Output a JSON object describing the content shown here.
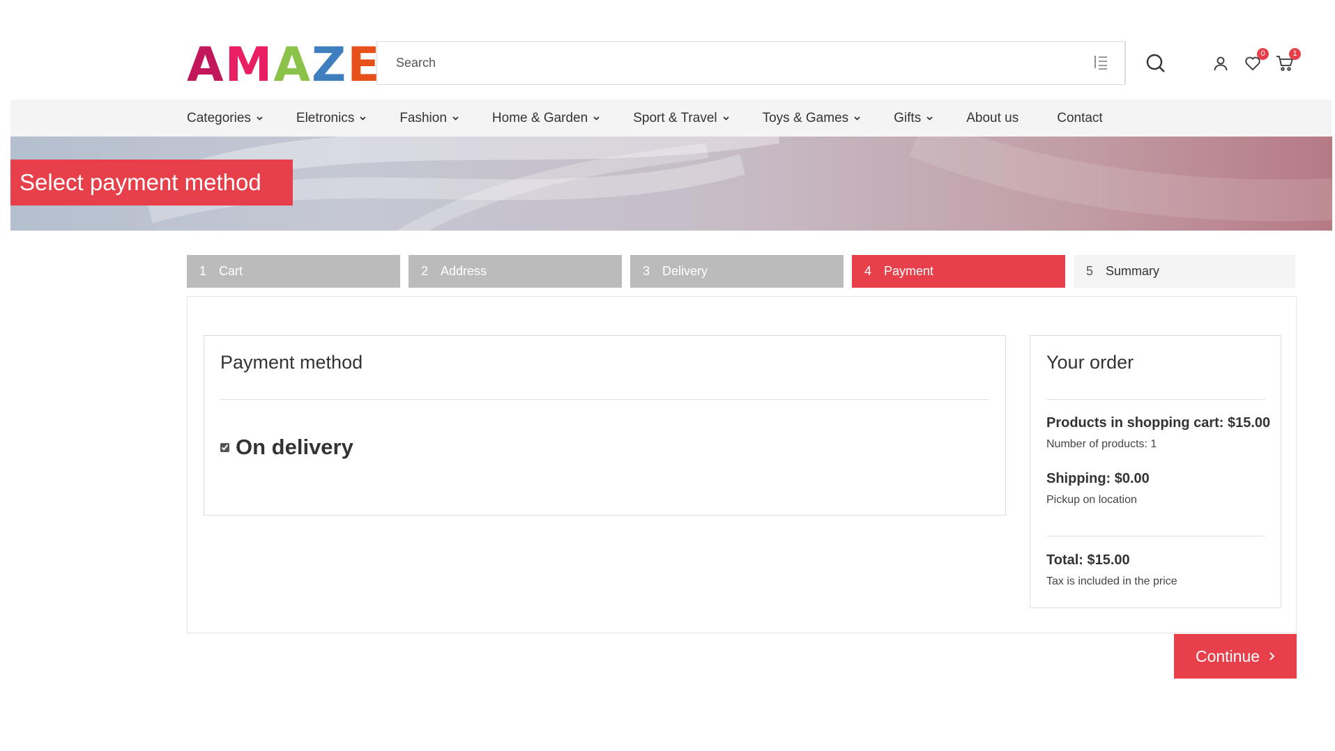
{
  "logo": {
    "letters": [
      "A",
      "M",
      "A",
      "Z",
      "E"
    ],
    "colors": [
      "#c2185b",
      "#e91e63",
      "#8bc34a",
      "#3f7fbf",
      "#e8501a"
    ]
  },
  "search": {
    "placeholder": "Search"
  },
  "header": {
    "wishlist_count": "0",
    "cart_count": "1"
  },
  "nav": {
    "items": [
      {
        "label": "Categories",
        "dropdown": true
      },
      {
        "label": "Eletronics",
        "dropdown": true
      },
      {
        "label": "Fashion",
        "dropdown": true
      },
      {
        "label": "Home & Garden",
        "dropdown": true
      },
      {
        "label": "Sport & Travel",
        "dropdown": true
      },
      {
        "label": "Toys & Games",
        "dropdown": true
      },
      {
        "label": "Gifts",
        "dropdown": true
      },
      {
        "label": "About us",
        "dropdown": false
      },
      {
        "label": "Contact",
        "dropdown": false
      }
    ]
  },
  "banner": {
    "title": "Select payment method"
  },
  "steps": [
    {
      "num": "1",
      "label": "Cart",
      "state": "done"
    },
    {
      "num": "2",
      "label": "Address",
      "state": "done"
    },
    {
      "num": "3",
      "label": "Delivery",
      "state": "done"
    },
    {
      "num": "4",
      "label": "Payment",
      "state": "active"
    },
    {
      "num": "5",
      "label": "Summary",
      "state": "future"
    }
  ],
  "payment": {
    "title": "Payment method",
    "option_label": "On delivery",
    "option_checked": true
  },
  "order": {
    "title": "Your order",
    "products_line": "Products in shopping cart: $15.00",
    "products_count": "Number of products: 1",
    "shipping_line": "Shipping: $0.00",
    "shipping_method": "Pickup on location",
    "total_line": "Total: $15.00",
    "tax_note": "Tax is included in the price"
  },
  "continue_label": "Continue",
  "colors": {
    "accent": "#e8404a",
    "step_done": "#bbbbbb",
    "nav_bg": "#f4f4f4"
  }
}
